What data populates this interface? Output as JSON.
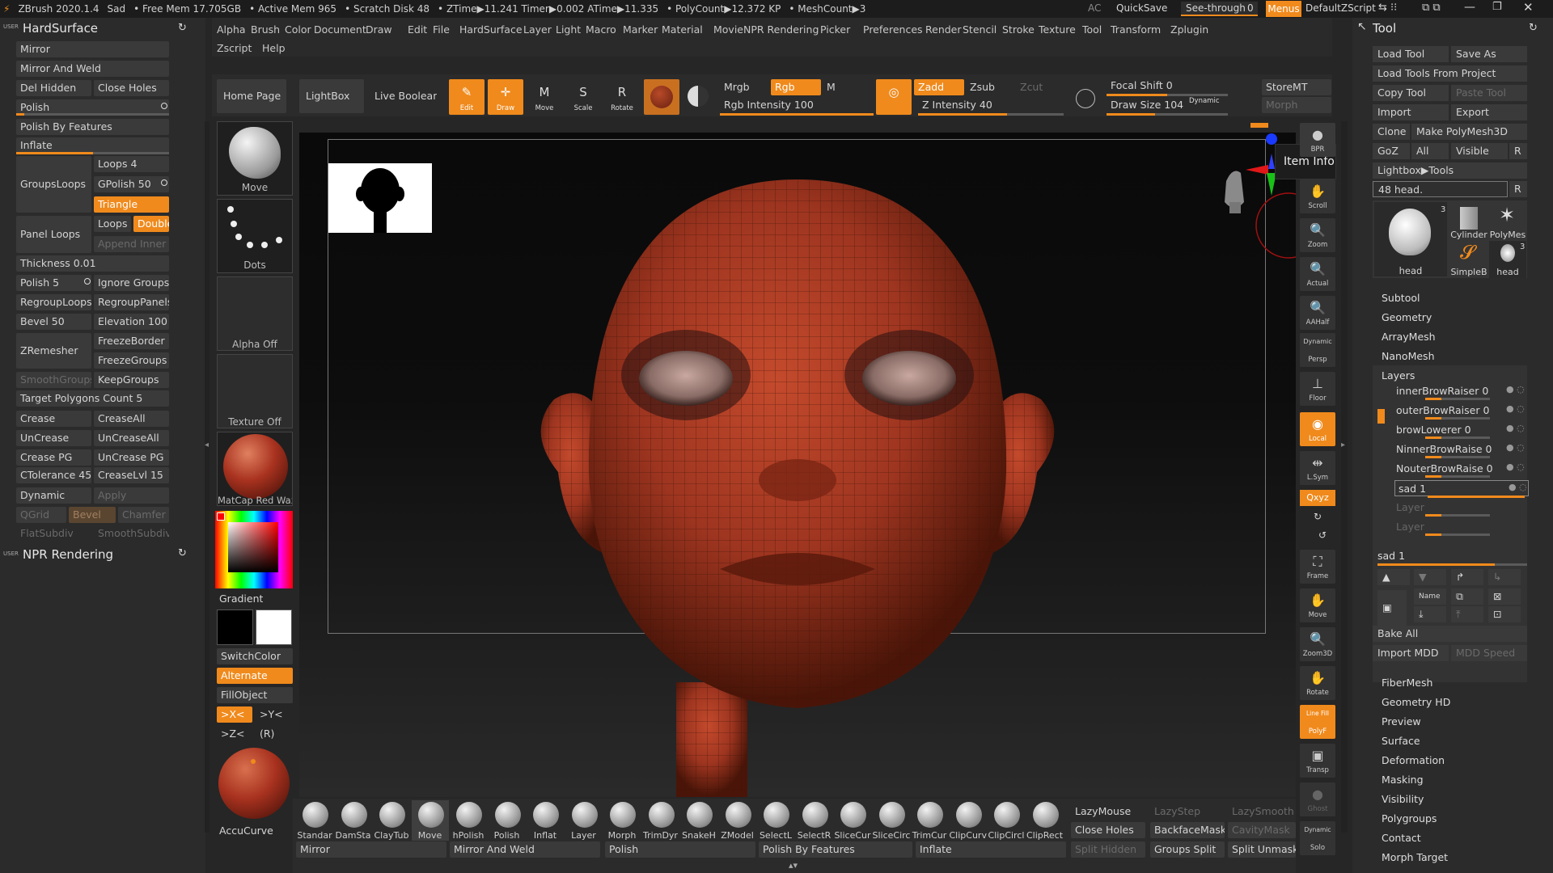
{
  "titlebar": {
    "app": "ZBrush 2020.1.4",
    "doc": "Sad",
    "free_mem": "• Free Mem 17.705GB",
    "active_mem": "• Active Mem 965",
    "scratch": "• Scratch Disk 48",
    "ztime": "• ZTime▶11.241 Timer▶0.002 ATime▶11.335",
    "polycount": "• PolyCount▶12.372 KP",
    "meshcount": "• MeshCount▶3",
    "ac": "AC",
    "quicksave": "QuickSave",
    "seethrough": "See-through",
    "seethrough_val": "0",
    "menus": "Menus",
    "script": "DefaultZScript"
  },
  "menubar": {
    "row1": [
      "Alpha",
      "Brush",
      "Color",
      "Document",
      "Draw",
      "Edit",
      "File",
      "HardSurface",
      "Layer",
      "Light",
      "Macro",
      "Marker",
      "Material",
      "Movie",
      "NPR Rendering",
      "Picker",
      "Preferences",
      "Render",
      "Stencil",
      "Stroke",
      "Texture",
      "Tool",
      "Transform",
      "Zplugin"
    ],
    "row2": [
      "Zscript",
      "Help"
    ]
  },
  "left": {
    "title": "HardSurface",
    "user": "USER",
    "mirror": "Mirror",
    "mirror_weld": "Mirror And Weld",
    "del_hidden": "Del Hidden",
    "close_holes": "Close Holes",
    "polish": "Polish",
    "polish_features": "Polish By Features",
    "inflate": "Inflate",
    "groupsloops": "GroupsLoops",
    "loops": "Loops 4",
    "gpolish": "GPolish 50",
    "triangle": "Triangle",
    "panel_loops": "Panel Loops",
    "loops2": "Loops",
    "double": "Double",
    "append_inner": "Append Inner",
    "thickness": "Thickness 0.01",
    "polish5": "Polish 5",
    "ignore_groups": "Ignore Groups",
    "regroup_loops": "RegroupLoops",
    "regroup_panels": "RegroupPanels",
    "bevel": "Bevel 50",
    "elevation": "Elevation 100",
    "zremesher": "ZRemesher",
    "freeze_border": "FreezeBorder",
    "freeze_groups": "FreezeGroups",
    "smooth_groups": "SmoothGroups",
    "keep_groups": "KeepGroups",
    "target_poly": "Target Polygons Count 5",
    "crease": "Crease",
    "crease_all": "CreaseAll",
    "uncrease": "UnCrease",
    "uncrease_all": "UnCreaseAll",
    "crease_pg": "Crease PG",
    "uncrease_pg": "UnCrease PG",
    "ctolerance": "CTolerance 45",
    "creaselvl": "CreaseLvl 15",
    "dynamic": "Dynamic",
    "apply": "Apply",
    "qgrid": "QGrid",
    "bevel2": "Bevel",
    "chamfer": "Chamfer",
    "flatsubdiv": "FlatSubdiv",
    "smoothsubdiv": "SmoothSubdiv",
    "npr_title": "NPR Rendering"
  },
  "shelf": {
    "home": "Home Page",
    "lightbox": "LightBox",
    "live_boolean": "Live Boolean",
    "edit": "Edit",
    "draw": "Draw",
    "move": "Move",
    "scale": "Scale",
    "rotate": "Rotate",
    "mrgb": "Mrgb",
    "rgb": "Rgb",
    "m": "M",
    "rgb_intensity": "Rgb Intensity 100",
    "zadd": "Zadd",
    "zsub": "Zsub",
    "zcut": "Zcut",
    "z_intensity": "Z Intensity 40",
    "focal_shift": "Focal Shift 0",
    "draw_size": "Draw Size 104",
    "dynamic": "Dynamic",
    "storemt": "StoreMT",
    "morph": "Morph"
  },
  "tray": {
    "move": "Move",
    "dots": "Dots",
    "alpha_off": "Alpha Off",
    "texture_off": "Texture Off",
    "matcap": "MatCap Red Wax",
    "gradient": "Gradient",
    "switchcolor": "SwitchColor",
    "alternate": "Alternate",
    "fillobject": "FillObject",
    "x": ">X<",
    "y": ">Y<",
    "z": ">Z<",
    "r": "(R)",
    "accucurve": "AccuCurve"
  },
  "canvas": {
    "item_info": "Item Info"
  },
  "rightbar": {
    "bpr": "BPR",
    "scroll": "Scroll",
    "zoom": "Zoom",
    "actual": "Actual",
    "aahalf": "AAHalf",
    "persp": "Persp",
    "dynamic": "Dynamic",
    "floor": "Floor",
    "local": "Local",
    "lsym": "L.Sym",
    "xyz": "Qxyz",
    "frame": "Frame",
    "move": "Move",
    "zoom3d": "Zoom3D",
    "rotate": "Rotate",
    "linefill": "Line Fill",
    "polyf": "PolyF",
    "transp": "Transp",
    "ghost": "Ghost",
    "solo": "Solo"
  },
  "bottom": {
    "brushes": [
      "Standar",
      "DamSta",
      "ClayTub",
      "Move",
      "hPolish",
      "Polish",
      "Inflat",
      "Layer",
      "Morph",
      "TrimDyr",
      "SnakeH",
      "ZModel",
      "SelectL",
      "SelectR",
      "SliceCur",
      "SliceCirc",
      "TrimCur",
      "ClipCurv",
      "ClipCircl",
      "ClipRect"
    ],
    "lazymouse": "LazyMouse",
    "lazystep": "LazyStep",
    "lazysmooth": "LazySmooth",
    "close_holes": "Close Holes",
    "backfacemask": "BackfaceMask",
    "cavitymask": "CavityMask",
    "split_hidden": "Split Hidden",
    "groups_split": "Groups Split",
    "split_unmasked": "Split Unmasked",
    "mirror": "Mirror",
    "mirror_weld": "Mirror And Weld",
    "polish": "Polish",
    "polish_features": "Polish By Features",
    "inflate": "Inflate"
  },
  "tool": {
    "title": "Tool",
    "load_tool": "Load Tool",
    "save_as": "Save As",
    "load_from_project": "Load Tools From Project",
    "copy_tool": "Copy Tool",
    "paste_tool": "Paste Tool",
    "import": "Import",
    "export": "Export",
    "clone": "Clone",
    "make_polymesh": "Make PolyMesh3D",
    "goz": "GoZ",
    "all": "All",
    "visible": "Visible",
    "r": "R",
    "lightbox_tools": "Lightbox▶Tools",
    "current_tool": "48 head.",
    "thumbs": [
      {
        "label": "head",
        "count": "3"
      },
      {
        "label": "Cylinder",
        ":count": ""
      },
      {
        "label": "PolyMes",
        "count": ""
      },
      {
        "label": "SimpleB",
        "count": ""
      },
      {
        "label": "head",
        "count": "3"
      }
    ],
    "subtool": "Subtool",
    "geometry": "Geometry",
    "arraymesh": "ArrayMesh",
    "nanomesh": "NanoMesh",
    "layers": "Layers",
    "layer_items": [
      {
        "name": "innerBrowRaiser 0"
      },
      {
        "name": "outerBrowRaiser 0"
      },
      {
        "name": "browLowerer 0"
      },
      {
        "name": "NinnerBrowRaise 0"
      },
      {
        "name": "NouterBrowRaise 0"
      },
      {
        "name": "sad 1"
      },
      {
        "name": "Layer"
      },
      {
        "name": "Layer"
      }
    ],
    "sad_value": "sad 1",
    "name_btn": "Name",
    "bake_all": "Bake All",
    "import_mdd": "Import MDD",
    "mdd_speed": "MDD Speed",
    "sections": [
      "FiberMesh",
      "Geometry HD",
      "Preview",
      "Surface",
      "Deformation",
      "Masking",
      "Visibility",
      "Polygroups",
      "Contact",
      "Morph Target"
    ]
  },
  "colors": {
    "accent": "#f08a1c",
    "panel": "#2b2b2b",
    "button": "#3a3a3a",
    "wax": "#a8321f"
  }
}
